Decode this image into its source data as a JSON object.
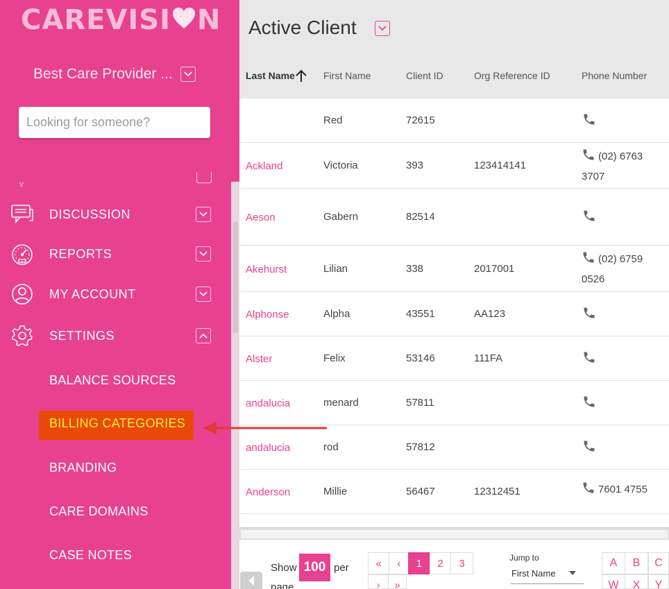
{
  "logo": {
    "part1": "CAREVISI",
    "heart": "♥",
    "part2": "N"
  },
  "provider": {
    "name": "Best Care Provider ..."
  },
  "search": {
    "placeholder": "Looking for someone?"
  },
  "partial_item": {
    "glyph": "v"
  },
  "nav": {
    "discussion": "DISCUSSION",
    "reports": "REPORTS",
    "my_account": "MY ACCOUNT",
    "settings": "SETTINGS"
  },
  "settings_sub": {
    "balance_sources": "BALANCE SOURCES",
    "billing_categories": "BILLING CATEGORIES",
    "branding": "BRANDING",
    "care_domains": "CARE DOMAINS",
    "case_notes": "CASE NOTES"
  },
  "main": {
    "title": "Active Client"
  },
  "table": {
    "columns": [
      "Last Name",
      "First Name",
      "Client ID",
      "Org Reference ID",
      "Phone Number"
    ],
    "rows": [
      {
        "last": "",
        "first": "Red",
        "id": "72615",
        "org": "",
        "phone1": "",
        "phone2": ""
      },
      {
        "last": "Ackland",
        "first": "Victoria",
        "id": "393",
        "org": "123414141",
        "phone1": "(02) 6763",
        "phone2": "3707"
      },
      {
        "last": "Aeson",
        "first": "Gabern",
        "id": "82514",
        "org": "",
        "phone1": "",
        "phone2": ""
      },
      {
        "last": "Akehurst",
        "first": "Lilian",
        "id": "338",
        "org": "2017001",
        "phone1": "(02) 6759",
        "phone2": "0526"
      },
      {
        "last": "Alphonse",
        "first": "Alpha",
        "id": "43551",
        "org": "AA123",
        "phone1": "",
        "phone2": ""
      },
      {
        "last": "Alster",
        "first": "Felix",
        "id": "53146",
        "org": "111FA",
        "phone1": "",
        "phone2": ""
      },
      {
        "last": "andalucia",
        "first": "menard",
        "id": "57811",
        "org": "",
        "phone1": "",
        "phone2": ""
      },
      {
        "last": "andalucia",
        "first": "rod",
        "id": "57812",
        "org": "",
        "phone1": "",
        "phone2": ""
      },
      {
        "last": "Anderson",
        "first": "Millie",
        "id": "56467",
        "org": "12312451",
        "phone1": "7601 4755",
        "phone2": ""
      }
    ]
  },
  "pagination": {
    "show_label": "Show",
    "show_value": "100",
    "per_label": "per",
    "page_label": "page",
    "first": "«",
    "prev": "‹",
    "pages": [
      "1",
      "2",
      "3"
    ],
    "next": "›",
    "last": "»",
    "current_page": "1"
  },
  "jump": {
    "label": "Jump to",
    "value": "First Name"
  },
  "alphabet": [
    "A",
    "B",
    "C",
    "W",
    "X",
    "Y"
  ],
  "colors": {
    "brand": "#e8418f",
    "highlight_bg": "#ea4a09",
    "highlight_text": "#ffee38",
    "annotation_arrow": "#e0393a"
  }
}
